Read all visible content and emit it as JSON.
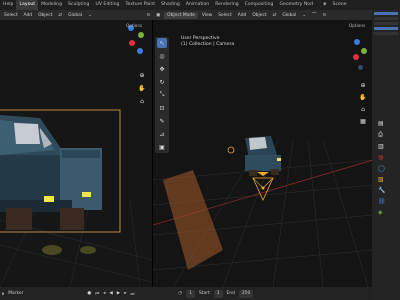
{
  "menu_tabs": [
    "Help",
    "Layout",
    "Modeling",
    "Sculpting",
    "UV Editing",
    "Texture Paint",
    "Shading",
    "Animation",
    "Rendering",
    "Compositing",
    "Geometry Nod"
  ],
  "active_tab": "Layout",
  "scene_label": "Scene",
  "left_header": {
    "select": "Select",
    "add": "Add",
    "object": "Object",
    "orientation": "Global"
  },
  "right_header": {
    "mode": "Object Mode",
    "view": "View",
    "select": "Select",
    "add": "Add",
    "object": "Object",
    "orientation": "Global"
  },
  "options_label": "Options",
  "viewport_info": {
    "line1": "User Perspective",
    "line2": "(1) Collection | Camera"
  },
  "timeline": {
    "marker": "Marker",
    "start_label": "Start",
    "start_value": "1",
    "end_label": "End",
    "end_value": "250"
  },
  "colors": {
    "accent": "#4772b3",
    "x_axis": "#e0303f",
    "y_axis": "#7ab33a",
    "z_axis": "#3a7fe0",
    "camera": "#f5a623",
    "selection": "#f0a040"
  }
}
